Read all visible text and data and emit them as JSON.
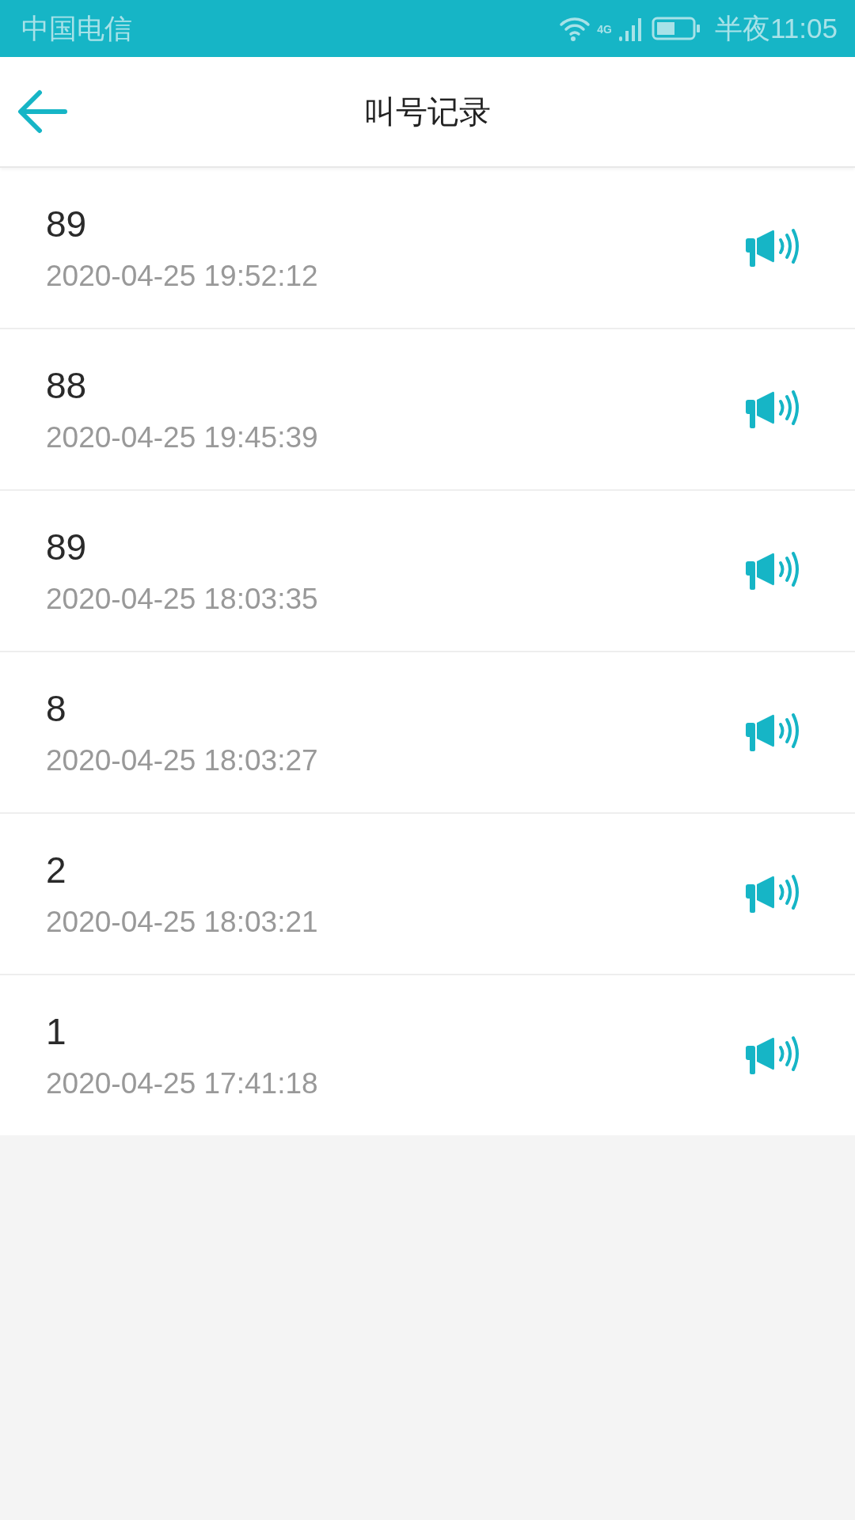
{
  "status_bar": {
    "carrier": "中国电信",
    "network": "4G",
    "time": "半夜11:05"
  },
  "header": {
    "title": "叫号记录"
  },
  "records": [
    {
      "number": "89",
      "time": "2020-04-25 19:52:12"
    },
    {
      "number": "88",
      "time": "2020-04-25 19:45:39"
    },
    {
      "number": "89",
      "time": "2020-04-25 18:03:35"
    },
    {
      "number": "8",
      "time": "2020-04-25 18:03:27"
    },
    {
      "number": "2",
      "time": "2020-04-25 18:03:21"
    },
    {
      "number": "1",
      "time": "2020-04-25 17:41:18"
    }
  ]
}
